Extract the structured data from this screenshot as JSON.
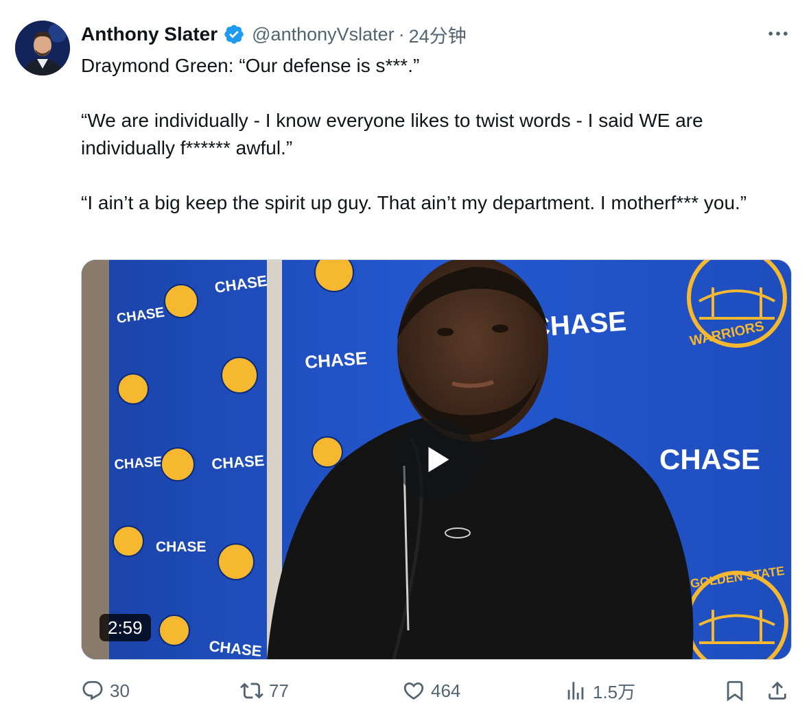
{
  "author": {
    "display_name": "Anthony Slater",
    "handle": "@anthonyVslater",
    "separator": "·",
    "time": "24分钟",
    "verified": true
  },
  "tweet": {
    "paragraphs": [
      "Draymond Green: “Our defense is s***.”",
      "“We are individually - I know everyone likes to twist words - I said WE are individually f****** awful.”",
      "“I ain’t a big keep the spirit up guy. That ain’t my department. I motherf*** you.”"
    ]
  },
  "media": {
    "type": "video",
    "duration": "2:59",
    "backdrop_text": [
      "CHASE",
      "CHASE",
      "CHASE",
      "CHASE",
      "CHASE",
      "CHASE",
      "CHASE",
      "CHASE",
      "CHASE"
    ],
    "logo_text": [
      "GOLDEN STATE",
      "WARRIORS"
    ]
  },
  "actions": {
    "replies": "30",
    "reposts": "77",
    "likes": "464",
    "views": "1.5万"
  },
  "colors": {
    "verified": "#1d9bf0",
    "secondary_text": "#536471",
    "primary_text": "#0f1419",
    "backdrop_blue": "#1d4fc0",
    "warriors_gold": "#f5b82e"
  },
  "icons": {
    "more": "more-horizontal-icon",
    "reply": "reply-icon",
    "repost": "repost-icon",
    "like": "heart-icon",
    "views": "views-icon",
    "bookmark": "bookmark-icon",
    "share": "share-icon",
    "play": "play-icon"
  }
}
